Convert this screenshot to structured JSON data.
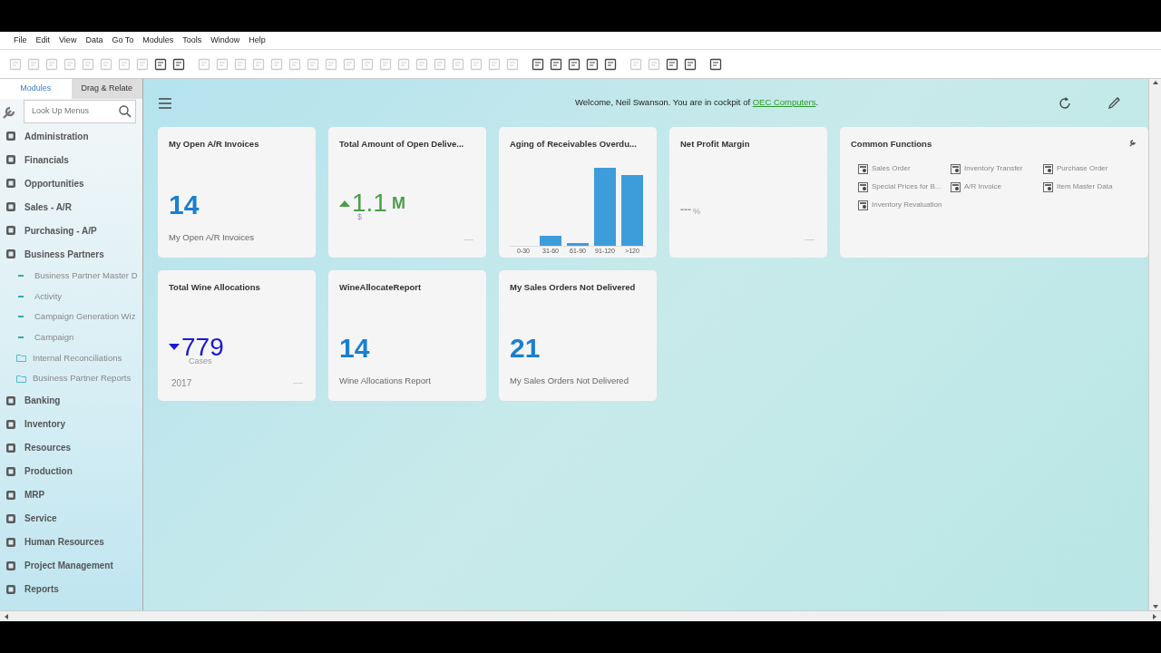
{
  "menu_bar": [
    "File",
    "Edit",
    "View",
    "Data",
    "Go To",
    "Modules",
    "Tools",
    "Window",
    "Help"
  ],
  "toolbar": [
    {
      "enabled": false
    },
    {
      "enabled": false
    },
    {
      "enabled": false
    },
    {
      "enabled": false
    },
    {
      "enabled": false
    },
    {
      "enabled": false
    },
    {
      "enabled": false
    },
    {
      "enabled": false
    },
    {
      "enabled": true
    },
    {
      "enabled": true
    },
    {
      "enabled": false
    },
    {
      "enabled": false
    },
    {
      "enabled": false
    },
    {
      "enabled": false
    },
    {
      "enabled": false
    },
    {
      "enabled": false
    },
    {
      "enabled": false
    },
    {
      "enabled": false
    },
    {
      "enabled": false
    },
    {
      "enabled": false
    },
    {
      "enabled": false
    },
    {
      "enabled": false
    },
    {
      "enabled": false
    },
    {
      "enabled": false
    },
    {
      "enabled": false
    },
    {
      "enabled": false
    },
    {
      "enabled": false
    },
    {
      "enabled": false
    },
    {
      "enabled": true
    },
    {
      "enabled": true
    },
    {
      "enabled": true
    },
    {
      "enabled": true
    },
    {
      "enabled": true
    },
    {
      "enabled": false
    },
    {
      "enabled": false
    },
    {
      "enabled": true
    },
    {
      "enabled": true
    },
    {
      "enabled": true
    }
  ],
  "sidebar": {
    "tabs": [
      {
        "label": "Modules",
        "selected": true
      },
      {
        "label": "Drag & Relate",
        "selected": false
      }
    ],
    "search": {
      "placeholder": "Look Up Menus"
    },
    "items": [
      {
        "kind": "module",
        "label": "Administration"
      },
      {
        "kind": "module",
        "label": "Financials"
      },
      {
        "kind": "module",
        "label": "Opportunities"
      },
      {
        "kind": "module",
        "label": "Sales - A/R"
      },
      {
        "kind": "module",
        "label": "Purchasing - A/P"
      },
      {
        "kind": "module",
        "label": "Business Partners",
        "children": [
          {
            "kind": "entry",
            "label": "Business Partner Master D"
          },
          {
            "kind": "entry",
            "label": "Activity"
          },
          {
            "kind": "entry",
            "label": "Campaign Generation Wiz"
          },
          {
            "kind": "entry",
            "label": "Campaign"
          },
          {
            "kind": "folder",
            "label": "Internal Reconciliations"
          },
          {
            "kind": "folder",
            "label": "Business Partner Reports"
          }
        ]
      },
      {
        "kind": "module",
        "label": "Banking"
      },
      {
        "kind": "module",
        "label": "Inventory"
      },
      {
        "kind": "module",
        "label": "Resources"
      },
      {
        "kind": "module",
        "label": "Production"
      },
      {
        "kind": "module",
        "label": "MRP"
      },
      {
        "kind": "module",
        "label": "Service"
      },
      {
        "kind": "module",
        "label": "Human Resources"
      },
      {
        "kind": "module",
        "label": "Project Management"
      },
      {
        "kind": "module",
        "label": "Reports"
      }
    ]
  },
  "header": {
    "welcome": "Welcome, Neil Swanson. You are in cockpit of ",
    "company": "OEC Computers",
    "end": "."
  },
  "tiles": [
    {
      "kind": "number",
      "title": "My Open A/R Invoices",
      "value": "14",
      "caption": "My Open A/R Invoices",
      "color": "#1a7fd1"
    },
    {
      "kind": "trend",
      "title": "Total Amount of Open Delive...",
      "up": true,
      "value": "1.1",
      "suffix": "M",
      "unit": "$",
      "footer": "----",
      "color": "#4a9e4a"
    },
    {
      "kind": "chart",
      "title": "Aging of Receivables Overdu...",
      "labels": [
        "0-30",
        "31-60",
        "61-90",
        "91-120",
        ">120"
      ]
    },
    {
      "kind": "empty",
      "title": "Net Profit Margin",
      "value": "---",
      "unit": "%",
      "footer": "----"
    },
    {
      "kind": "functions",
      "title": "Common Functions",
      "items": [
        "Sales Order",
        "Inventory Transfer",
        "Purchase Order",
        "Special Prices for B...",
        "A/R Invoice",
        "Item Master Data",
        "Inventory Revaluation"
      ]
    },
    {
      "kind": "trend",
      "title": "Total Wine Allocations",
      "up": false,
      "value": "779",
      "unit": "Cases",
      "sub": "2017",
      "footer": "----",
      "color": "#1a1ad1"
    },
    {
      "kind": "number",
      "title": "WineAllocateReport",
      "value": "14",
      "caption": "Wine Allocations Report",
      "color": "#1a7fd1"
    },
    {
      "kind": "number",
      "title": "My Sales Orders Not Delivered",
      "value": "21",
      "caption": "My Sales Orders Not Delivered",
      "color": "#1a7fd1"
    }
  ]
}
